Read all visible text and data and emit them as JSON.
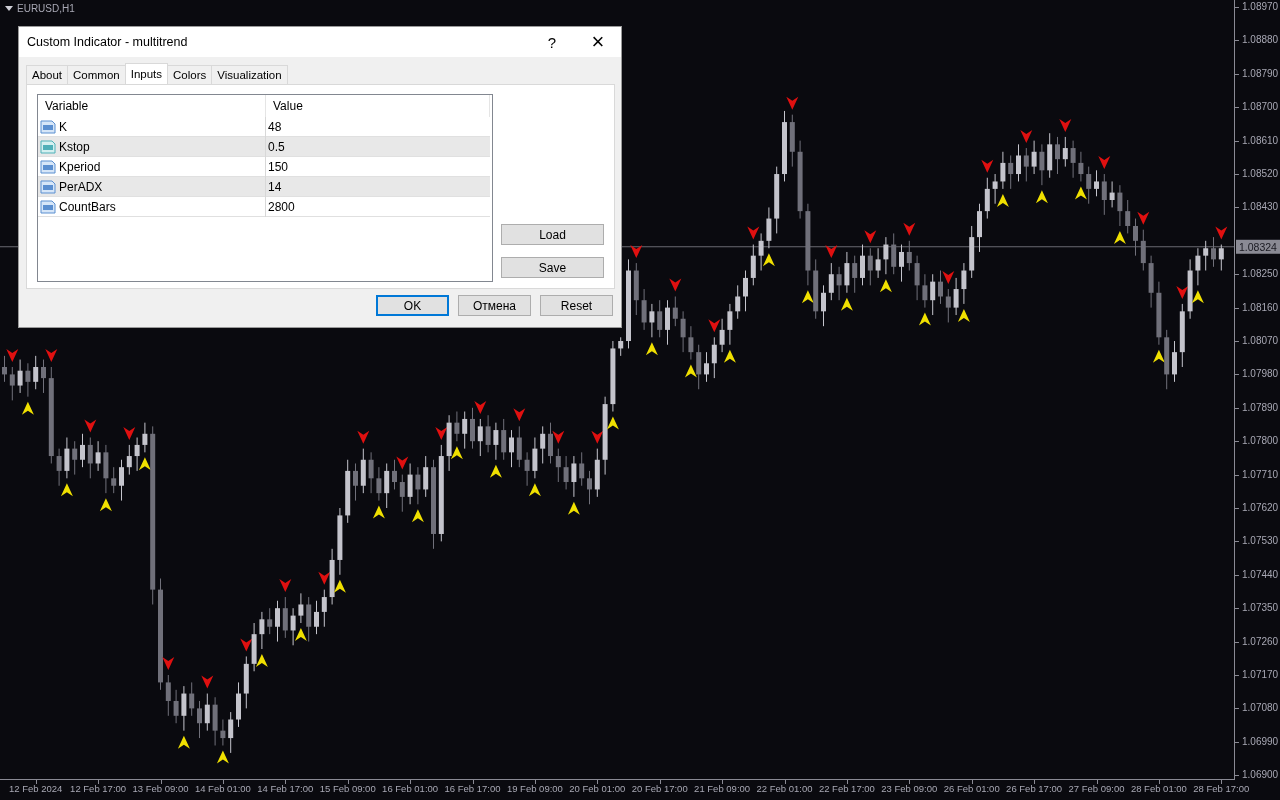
{
  "chart": {
    "symbol": "EURUSD,H1",
    "chart_data": {
      "type": "candlestick",
      "ylim": [
        1.06887,
        1.08989
      ],
      "ref_lines": [
        {
          "axis": "y",
          "value": 1.08324,
          "label": "1.08324"
        }
      ],
      "categories": [
        null,
        null,
        null,
        null,
        "12 Feb 2024",
        null,
        null,
        null,
        null,
        null,
        null,
        null,
        "12 Feb 17:00",
        null,
        null,
        null,
        null,
        null,
        null,
        null,
        "13 Feb 09:00",
        null,
        null,
        null,
        null,
        null,
        null,
        null,
        "14 Feb 01:00",
        null,
        null,
        null,
        null,
        null,
        null,
        null,
        "14 Feb 17:00",
        null,
        null,
        null,
        null,
        null,
        null,
        null,
        "15 Feb 09:00",
        null,
        null,
        null,
        null,
        null,
        null,
        null,
        "16 Feb 01:00",
        null,
        null,
        null,
        null,
        null,
        null,
        null,
        "16 Feb 17:00",
        null,
        null,
        null,
        null,
        null,
        null,
        null,
        "19 Feb 09:00",
        null,
        null,
        null,
        null,
        null,
        null,
        null,
        "20 Feb 01:00",
        null,
        null,
        null,
        null,
        null,
        null,
        null,
        "20 Feb 17:00",
        null,
        null,
        null,
        null,
        null,
        null,
        null,
        "21 Feb 09:00",
        null,
        null,
        null,
        null,
        null,
        null,
        null,
        "22 Feb 01:00",
        null,
        null,
        null,
        null,
        null,
        null,
        null,
        "22 Feb 17:00",
        null,
        null,
        null,
        null,
        null,
        null,
        null,
        "23 Feb 09:00",
        null,
        null,
        null,
        null,
        null,
        null,
        null,
        "26 Feb 01:00",
        null,
        null,
        null,
        null,
        null,
        null,
        null,
        "26 Feb 17:00",
        null,
        null,
        null,
        null,
        null,
        null,
        null,
        "27 Feb 09:00",
        null,
        null,
        null,
        null,
        null,
        null,
        null,
        "28 Feb 01:00",
        null,
        null,
        null,
        null,
        null,
        null,
        null,
        "28 Feb 17:00"
      ],
      "yticks": [
        {
          "value": 1.0897,
          "label": "1.08970"
        },
        {
          "value": 1.0888,
          "label": "1.08880"
        },
        {
          "value": 1.0879,
          "label": "1.08790"
        },
        {
          "value": 1.087,
          "label": "1.08700"
        },
        {
          "value": 1.0861,
          "label": "1.08610"
        },
        {
          "value": 1.0852,
          "label": "1.08520"
        },
        {
          "value": 1.0843,
          "label": "1.08430"
        },
        {
          "value": 1.0825,
          "label": "1.08250"
        },
        {
          "value": 1.0816,
          "label": "1.08160"
        },
        {
          "value": 1.0807,
          "label": "1.08070"
        },
        {
          "value": 1.0798,
          "label": "1.07980"
        },
        {
          "value": 1.0789,
          "label": "1.07890"
        },
        {
          "value": 1.078,
          "label": "1.07800"
        },
        {
          "value": 1.0771,
          "label": "1.07710"
        },
        {
          "value": 1.0762,
          "label": "1.07620"
        },
        {
          "value": 1.0753,
          "label": "1.07530"
        },
        {
          "value": 1.0744,
          "label": "1.07440"
        },
        {
          "value": 1.0735,
          "label": "1.07350"
        },
        {
          "value": 1.0726,
          "label": "1.07260"
        },
        {
          "value": 1.0717,
          "label": "1.07170"
        },
        {
          "value": 1.0708,
          "label": "1.07080"
        },
        {
          "value": 1.0699,
          "label": "1.06990"
        },
        {
          "value": 1.069,
          "label": "1.06900"
        }
      ],
      "ohlc": [
        [
          1.08,
          1.0803,
          1.0796,
          1.0798
        ],
        [
          1.0798,
          1.08,
          1.0791,
          1.0795
        ],
        [
          1.0795,
          1.0802,
          1.0793,
          1.0799
        ],
        [
          1.0799,
          1.0801,
          1.0792,
          1.0796
        ],
        [
          1.0796,
          1.0803,
          1.0794,
          1.08
        ],
        [
          1.08,
          1.0802,
          1.0793,
          1.0797
        ],
        [
          1.0797,
          1.08,
          1.0774,
          1.0776
        ],
        [
          1.0776,
          1.0778,
          1.0768,
          1.0772
        ],
        [
          1.0772,
          1.0781,
          1.077,
          1.0778
        ],
        [
          1.0778,
          1.078,
          1.0771,
          1.0775
        ],
        [
          1.0775,
          1.0782,
          1.0773,
          1.0779
        ],
        [
          1.0779,
          1.0781,
          1.077,
          1.0774
        ],
        [
          1.0774,
          1.078,
          1.0772,
          1.0777
        ],
        [
          1.0777,
          1.0779,
          1.0766,
          1.077
        ],
        [
          1.077,
          1.0773,
          1.0766,
          1.0768
        ],
        [
          1.0768,
          1.0775,
          1.0764,
          1.0773
        ],
        [
          1.0773,
          1.0779,
          1.0771,
          1.0776
        ],
        [
          1.0776,
          1.0781,
          1.0772,
          1.0779
        ],
        [
          1.0779,
          1.0785,
          1.0777,
          1.0782
        ],
        [
          1.0782,
          1.0784,
          1.0736,
          1.074
        ],
        [
          1.074,
          1.0743,
          1.0713,
          1.0715
        ],
        [
          1.0715,
          1.0717,
          1.0706,
          1.071
        ],
        [
          1.071,
          1.0713,
          1.0704,
          1.0706
        ],
        [
          1.0706,
          1.0714,
          1.0702,
          1.0712
        ],
        [
          1.0712,
          1.0715,
          1.0706,
          1.0708
        ],
        [
          1.0708,
          1.071,
          1.07,
          1.0704
        ],
        [
          1.0704,
          1.0712,
          1.0702,
          1.0709
        ],
        [
          1.0709,
          1.0711,
          1.0698,
          1.0702
        ],
        [
          1.0702,
          1.0705,
          1.0698,
          1.07
        ],
        [
          1.07,
          1.0707,
          1.0696,
          1.0705
        ],
        [
          1.0705,
          1.0715,
          1.0703,
          1.0712
        ],
        [
          1.0712,
          1.0722,
          1.0708,
          1.072
        ],
        [
          1.072,
          1.0731,
          1.0718,
          1.0728
        ],
        [
          1.0728,
          1.0734,
          1.0724,
          1.0732
        ],
        [
          1.0732,
          1.0735,
          1.0728,
          1.073
        ],
        [
          1.073,
          1.0737,
          1.0726,
          1.0735
        ],
        [
          1.0735,
          1.0738,
          1.0727,
          1.0729
        ],
        [
          1.0729,
          1.0735,
          1.0725,
          1.0733
        ],
        [
          1.0733,
          1.0739,
          1.0731,
          1.0736
        ],
        [
          1.0736,
          1.0738,
          1.0726,
          1.073
        ],
        [
          1.073,
          1.0737,
          1.0728,
          1.0734
        ],
        [
          1.0734,
          1.074,
          1.073,
          1.0738
        ],
        [
          1.0738,
          1.0751,
          1.0736,
          1.0748
        ],
        [
          1.0748,
          1.0762,
          1.0744,
          1.076
        ],
        [
          1.076,
          1.0775,
          1.0758,
          1.0772
        ],
        [
          1.0772,
          1.0774,
          1.0764,
          1.0768
        ],
        [
          1.0768,
          1.0778,
          1.0766,
          1.0775
        ],
        [
          1.0775,
          1.0777,
          1.0766,
          1.077
        ],
        [
          1.077,
          1.0773,
          1.0764,
          1.0766
        ],
        [
          1.0766,
          1.0774,
          1.0762,
          1.0772
        ],
        [
          1.0772,
          1.0775,
          1.0767,
          1.0769
        ],
        [
          1.0769,
          1.0771,
          1.0761,
          1.0765
        ],
        [
          1.0765,
          1.0774,
          1.0763,
          1.0771
        ],
        [
          1.0771,
          1.0773,
          1.0763,
          1.0767
        ],
        [
          1.0767,
          1.0776,
          1.0765,
          1.0773
        ],
        [
          1.0773,
          1.0775,
          1.0751,
          1.0755
        ],
        [
          1.0755,
          1.0779,
          1.0753,
          1.0776
        ],
        [
          1.0776,
          1.0787,
          1.0772,
          1.0785
        ],
        [
          1.0785,
          1.0788,
          1.078,
          1.0782
        ],
        [
          1.0782,
          1.0788,
          1.0778,
          1.0786
        ],
        [
          1.0786,
          1.0789,
          1.0778,
          1.078
        ],
        [
          1.078,
          1.0786,
          1.0776,
          1.0784
        ],
        [
          1.0784,
          1.0787,
          1.0777,
          1.0779
        ],
        [
          1.0779,
          1.0785,
          1.0775,
          1.0783
        ],
        [
          1.0783,
          1.0786,
          1.0775,
          1.0777
        ],
        [
          1.0777,
          1.0783,
          1.0773,
          1.0781
        ],
        [
          1.0781,
          1.0784,
          1.0773,
          1.0775
        ],
        [
          1.0775,
          1.0777,
          1.0768,
          1.0772
        ],
        [
          1.0772,
          1.0781,
          1.077,
          1.0778
        ],
        [
          1.0778,
          1.0784,
          1.0774,
          1.0782
        ],
        [
          1.0782,
          1.0785,
          1.0774,
          1.0776
        ],
        [
          1.0776,
          1.0778,
          1.0769,
          1.0773
        ],
        [
          1.0773,
          1.0776,
          1.0767,
          1.0769
        ],
        [
          1.0769,
          1.0776,
          1.0765,
          1.0774
        ],
        [
          1.0774,
          1.0777,
          1.0768,
          1.077
        ],
        [
          1.077,
          1.0772,
          1.0763,
          1.0767
        ],
        [
          1.0767,
          1.0778,
          1.0765,
          1.0775
        ],
        [
          1.0775,
          1.0792,
          1.0771,
          1.079
        ],
        [
          1.079,
          1.0807,
          1.0788,
          1.0805
        ],
        [
          1.0805,
          1.0808,
          1.0803,
          1.0807
        ],
        [
          1.0807,
          1.0829,
          1.0805,
          1.0826
        ],
        [
          1.0826,
          1.0828,
          1.0814,
          1.0818
        ],
        [
          1.0818,
          1.0821,
          1.081,
          1.0812
        ],
        [
          1.0812,
          1.0817,
          1.0808,
          1.0815
        ],
        [
          1.0815,
          1.0818,
          1.0808,
          1.081
        ],
        [
          1.081,
          1.0818,
          1.0806,
          1.0816
        ],
        [
          1.0816,
          1.0819,
          1.0811,
          1.0813
        ],
        [
          1.0813,
          1.0815,
          1.0804,
          1.0808
        ],
        [
          1.0808,
          1.0811,
          1.0802,
          1.0804
        ],
        [
          1.0804,
          1.0806,
          1.0794,
          1.0798
        ],
        [
          1.0798,
          1.0804,
          1.0796,
          1.0801
        ],
        [
          1.0801,
          1.0808,
          1.0797,
          1.0806
        ],
        [
          1.0806,
          1.0813,
          1.0804,
          1.081
        ],
        [
          1.081,
          1.0817,
          1.0806,
          1.0815
        ],
        [
          1.0815,
          1.0822,
          1.0813,
          1.0819
        ],
        [
          1.0819,
          1.0826,
          1.0815,
          1.0824
        ],
        [
          1.0824,
          1.0833,
          1.0822,
          1.083
        ],
        [
          1.083,
          1.0836,
          1.0826,
          1.0834
        ],
        [
          1.0834,
          1.0843,
          1.0832,
          1.084
        ],
        [
          1.084,
          1.0854,
          1.0836,
          1.0852
        ],
        [
          1.0852,
          1.0869,
          1.085,
          1.0866
        ],
        [
          1.0866,
          1.0868,
          1.0854,
          1.0858
        ],
        [
          1.0858,
          1.0861,
          1.084,
          1.0842
        ],
        [
          1.0842,
          1.0844,
          1.0822,
          1.0826
        ],
        [
          1.0826,
          1.0829,
          1.0813,
          1.0815
        ],
        [
          1.0815,
          1.0822,
          1.0811,
          1.082
        ],
        [
          1.082,
          1.0828,
          1.0818,
          1.0825
        ],
        [
          1.0825,
          1.0827,
          1.0818,
          1.0822
        ],
        [
          1.0822,
          1.0831,
          1.082,
          1.0828
        ],
        [
          1.0828,
          1.083,
          1.082,
          1.0824
        ],
        [
          1.0824,
          1.0833,
          1.0822,
          1.083
        ],
        [
          1.083,
          1.0832,
          1.0822,
          1.0826
        ],
        [
          1.0826,
          1.0832,
          1.0824,
          1.0829
        ],
        [
          1.0829,
          1.0835,
          1.0825,
          1.0833
        ],
        [
          1.0833,
          1.0836,
          1.0825,
          1.0827
        ],
        [
          1.0827,
          1.0833,
          1.0823,
          1.0831
        ],
        [
          1.0831,
          1.0834,
          1.0826,
          1.0828
        ],
        [
          1.0828,
          1.083,
          1.0818,
          1.0822
        ],
        [
          1.0822,
          1.0825,
          1.0816,
          1.0818
        ],
        [
          1.0818,
          1.0825,
          1.0814,
          1.0823
        ],
        [
          1.0823,
          1.0826,
          1.0817,
          1.0819
        ],
        [
          1.0819,
          1.0821,
          1.0812,
          1.0816
        ],
        [
          1.0816,
          1.0824,
          1.0814,
          1.0821
        ],
        [
          1.0821,
          1.0828,
          1.0817,
          1.0826
        ],
        [
          1.0826,
          1.0838,
          1.0824,
          1.0835
        ],
        [
          1.0835,
          1.0844,
          1.0831,
          1.0842
        ],
        [
          1.0842,
          1.0851,
          1.084,
          1.0848
        ],
        [
          1.0848,
          1.0852,
          1.0844,
          1.085
        ],
        [
          1.085,
          1.0858,
          1.0848,
          1.0855
        ],
        [
          1.0855,
          1.0857,
          1.0848,
          1.0852
        ],
        [
          1.0852,
          1.086,
          1.085,
          1.0857
        ],
        [
          1.0857,
          1.0859,
          1.085,
          1.0854
        ],
        [
          1.0854,
          1.0861,
          1.0852,
          1.0858
        ],
        [
          1.0858,
          1.086,
          1.0849,
          1.0853
        ],
        [
          1.0853,
          1.0863,
          1.0851,
          1.086
        ],
        [
          1.086,
          1.0862,
          1.0852,
          1.0856
        ],
        [
          1.0856,
          1.0862,
          1.0854,
          1.0859
        ],
        [
          1.0859,
          1.0861,
          1.0851,
          1.0855
        ],
        [
          1.0855,
          1.0858,
          1.085,
          1.0852
        ],
        [
          1.0852,
          1.0854,
          1.0844,
          1.0848
        ],
        [
          1.0848,
          1.0853,
          1.0846,
          1.085
        ],
        [
          1.085,
          1.0852,
          1.0841,
          1.0845
        ],
        [
          1.0845,
          1.085,
          1.0843,
          1.0847
        ],
        [
          1.0847,
          1.0849,
          1.0838,
          1.0842
        ],
        [
          1.0842,
          1.0845,
          1.0836,
          1.0838
        ],
        [
          1.0838,
          1.084,
          1.083,
          1.0834
        ],
        [
          1.0834,
          1.0837,
          1.0826,
          1.0828
        ],
        [
          1.0828,
          1.083,
          1.0816,
          1.082
        ],
        [
          1.082,
          1.0823,
          1.0806,
          1.0808
        ],
        [
          1.0808,
          1.081,
          1.0794,
          1.0798
        ],
        [
          1.0798,
          1.0807,
          1.0796,
          1.0804
        ],
        [
          1.0804,
          1.0817,
          1.08,
          1.0815
        ],
        [
          1.0815,
          1.0829,
          1.0813,
          1.0826
        ],
        [
          1.0826,
          1.0832,
          1.0822,
          1.083
        ],
        [
          1.083,
          1.0834,
          1.0826,
          1.0832
        ],
        [
          1.0832,
          1.0835,
          1.0827,
          1.0829
        ],
        [
          1.0829,
          1.0833,
          1.0826,
          1.0832
        ]
      ]
    }
  },
  "dialog": {
    "title": "Custom Indicator - multitrend",
    "help": "?",
    "close": "×",
    "tabs": [
      {
        "label": "About",
        "selected": false
      },
      {
        "label": "Common",
        "selected": false
      },
      {
        "label": "Inputs",
        "selected": true
      },
      {
        "label": "Colors",
        "selected": false
      },
      {
        "label": "Visualization",
        "selected": false
      }
    ],
    "table": {
      "columns": [
        "Variable",
        "Value"
      ],
      "rows": [
        {
          "kind": "int",
          "variable": "K",
          "value": "48"
        },
        {
          "kind": "double",
          "variable": "Kstop",
          "value": "0.5"
        },
        {
          "kind": "int",
          "variable": "Kperiod",
          "value": "150"
        },
        {
          "kind": "int",
          "variable": "PerADX",
          "value": "14"
        },
        {
          "kind": "int",
          "variable": "CountBars",
          "value": "2800"
        }
      ]
    },
    "side_buttons": [
      "Load",
      "Save"
    ],
    "buttons": [
      {
        "label": "OK",
        "default": true
      },
      {
        "label": "Отмена",
        "default": false
      },
      {
        "label": "Reset",
        "default": false
      }
    ]
  }
}
